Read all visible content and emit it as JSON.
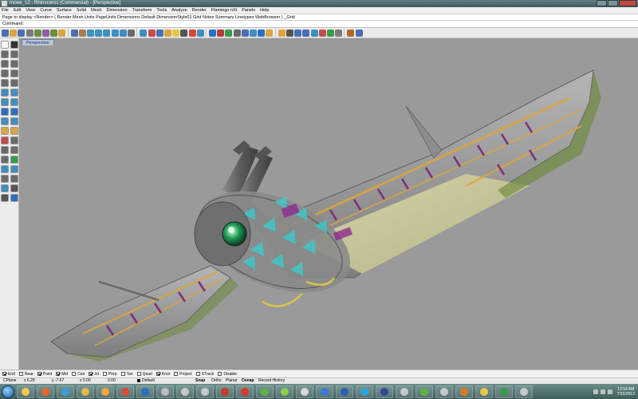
{
  "window": {
    "title": "mcwe_12 - Rhinoceros (Commercial) - [Perspective]"
  },
  "menu": [
    "File",
    "Edit",
    "View",
    "Curve",
    "Surface",
    "Solid",
    "Mesh",
    "Dimension",
    "Transform",
    "Tools",
    "Analyze",
    "Render",
    "Flamingo nXt",
    "Panels",
    "Help"
  ],
  "command_history": "Page to display <Render> ( Render Mesh Units PageUnits Dimensions Default DimensionStyle01 Grid Notes Summary Linetypes WebBrowser ) _Grid",
  "command_prompt": "Command:",
  "toolbar": {
    "icons": [
      "new-icon",
      "open-icon",
      "save-icon",
      "print-icon",
      "import-icon",
      "cut-icon",
      "copy-icon",
      "paste-icon",
      "undo-icon",
      "pan-icon",
      "rotate-view-icon",
      "zoom-dynamic-icon",
      "zoom-window-icon",
      "zoom-extents-icon",
      "zoom-selected-icon",
      "undo-view-icon",
      "four-views-icon",
      "cplane-icon",
      "properties-icon",
      "layer-icon",
      "lightbulb-icon",
      "select-icon",
      "color-wheel-icon",
      "wireframe-icon",
      "render-icon",
      "material-icon",
      "environment-icon",
      "options-icon",
      "grid-icon",
      "layout-icon",
      "render-preview-icon",
      "flamingo-icon",
      "sun-icon",
      "camera-icon",
      "text-icon",
      "dimension-icon",
      "curve-icon",
      "surface-icon",
      "solid-icon",
      "mesh-icon",
      "analyze-icon",
      "help-icon"
    ],
    "colors": [
      "#4a6fb3",
      "#d9a441",
      "#4a6fb3",
      "#7a7a7a",
      "#6b8e3d",
      "#8f5da8",
      "#6b8e3d",
      "#d9a441",
      "#4a6fb3",
      "#a77d4c",
      "#3f8fbf",
      "#3f8fbf",
      "#3f8fbf",
      "#3f8fbf",
      "#3f8fbf",
      "#6b6b6b",
      "#3f8fbf",
      "#c44c4c",
      "#4a6fb3",
      "#d9a441",
      "#e5c747",
      "#555555",
      "#d44a3a",
      "#3f8fbf",
      "#2b6fc2",
      "#b33b3b",
      "#3a9a4a",
      "#6a6a6a",
      "#4a6fb3",
      "#3f8fbf",
      "#2b6fc2",
      "#d9a441",
      "#e5a23a",
      "#555555",
      "#4a6fb3",
      "#4a6fb3",
      "#3f8fbf",
      "#c44c4c",
      "#3a9a4a",
      "#7a7a7a",
      "#b36a2b",
      "#4a6fb3"
    ]
  },
  "palette": {
    "icons": [
      "select-icon",
      "point-icon",
      "line-icon",
      "polyline-icon",
      "curve-icon",
      "arc-icon",
      "circle-icon",
      "rectangle-icon",
      "ellipse-icon",
      "polygon-icon",
      "freeform-icon",
      "offset-icon",
      "surface-icon",
      "loft-icon",
      "solid-box-icon",
      "solid-sphere-icon",
      "mesh-icon",
      "boolean-icon",
      "fillet-icon",
      "trim-icon",
      "split-icon",
      "join-icon",
      "explode-icon",
      "group-icon",
      "move-icon",
      "copy-icon",
      "rotate-icon",
      "scale-icon",
      "mirror-icon",
      "array-icon",
      "analyze-icon",
      "text-icon",
      "dimension-icon",
      "render-icon"
    ],
    "colors": [
      "#f7f7f7",
      "#333333",
      "#6b6b6b",
      "#6b6b6b",
      "#6b6b6b",
      "#6b6b6b",
      "#6b6b6b",
      "#6b6b6b",
      "#6b6b6b",
      "#6b6b6b",
      "#3f8fbf",
      "#3f8fbf",
      "#3f8fbf",
      "#3f8fbf",
      "#2b6fc2",
      "#2b6fc2",
      "#3f8fbf",
      "#3f8fbf",
      "#d9a441",
      "#d9a441",
      "#c44c4c",
      "#6b6b6b",
      "#6b6b6b",
      "#6b6b6b",
      "#6b6b6b",
      "#3a9a4a",
      "#3f8fbf",
      "#3f8fbf",
      "#6b6b6b",
      "#6b6b6b",
      "#3f8fbf",
      "#555555",
      "#555555",
      "#2b6fc2"
    ]
  },
  "viewport": {
    "label": "Perspective",
    "background": "#9a9a9a"
  },
  "osnaps": [
    {
      "label": "End",
      "on": true
    },
    {
      "label": "Near",
      "on": false
    },
    {
      "label": "Point",
      "on": true
    },
    {
      "label": "Mid",
      "on": true
    },
    {
      "label": "Cen",
      "on": false
    },
    {
      "label": "Int",
      "on": true
    },
    {
      "label": "Perp",
      "on": false
    },
    {
      "label": "Tan",
      "on": false
    },
    {
      "label": "Quad",
      "on": false
    },
    {
      "label": "Knot",
      "on": true
    },
    {
      "label": "Project",
      "on": false
    },
    {
      "label": "STrack",
      "on": false
    },
    {
      "label": "Disable",
      "on": false
    }
  ],
  "status": {
    "cplane": "CPlane",
    "x": "x 6.28",
    "y": "y -7.67",
    "z": "z 0.00",
    "z_val": "0.00",
    "layer": "Default",
    "toggles": [
      "Snap",
      "Ortho",
      "Planar",
      "Osnap",
      "Record History"
    ]
  },
  "taskbar": {
    "apps": [
      {
        "name": "explorer-icon",
        "color": "#f2c94c"
      },
      {
        "name": "firefox-icon",
        "color": "#e8652d"
      },
      {
        "name": "ie-icon",
        "color": "#3a9ad9"
      },
      {
        "name": "folder-icon",
        "color": "#e5b84a"
      },
      {
        "name": "media-player-icon",
        "color": "#f0a640"
      },
      {
        "name": "sketchup-icon",
        "color": "#d94a3a"
      },
      {
        "name": "photoshop-icon",
        "color": "#2b6fc2"
      },
      {
        "name": "rhino-icon",
        "color": "#bdbdbd"
      },
      {
        "name": "swirl-icon",
        "color": "#c9c9c9"
      },
      {
        "name": "winamp-icon",
        "color": "#c9c9c9"
      },
      {
        "name": "acrobat-icon",
        "color": "#c9392c"
      },
      {
        "name": "red-app-icon",
        "color": "#d43a2c"
      },
      {
        "name": "green-app-icon",
        "color": "#5fb346"
      },
      {
        "name": "leaf-icon",
        "color": "#8ecf4a"
      },
      {
        "name": "note-icon",
        "color": "#d9d9d9"
      },
      {
        "name": "blue-app-icon",
        "color": "#3a7bd5"
      },
      {
        "name": "word-icon",
        "color": "#2b5fb3"
      },
      {
        "name": "skype-icon",
        "color": "#2aa4e0"
      },
      {
        "name": "eye-icon",
        "color": "#2d4a9a"
      },
      {
        "name": "lock-icon",
        "color": "#c9c9c9"
      },
      {
        "name": "green-disk-icon",
        "color": "#5fb346"
      },
      {
        "name": "swirl2-icon",
        "color": "#c9c9c9"
      },
      {
        "name": "ppt-icon",
        "color": "#d9782d"
      },
      {
        "name": "outlook-icon",
        "color": "#e5c747"
      },
      {
        "name": "green-square-icon",
        "color": "#3a9a4a"
      },
      {
        "name": "spiral-icon",
        "color": "#c9c9c9"
      }
    ],
    "time": "12:54 AM",
    "date": "7/15/2012"
  }
}
